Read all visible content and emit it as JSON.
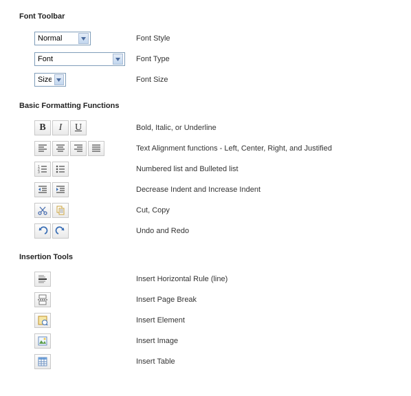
{
  "sections": {
    "font_toolbar": {
      "title": "Font Toolbar",
      "style_dd": "Normal",
      "style_desc": "Font Style",
      "font_dd": "Font",
      "font_desc": "Font Type",
      "size_dd": "Size",
      "size_desc": "Font Size"
    },
    "basic": {
      "title": "Basic Formatting Functions",
      "biu_desc": "Bold, Italic, or Underline",
      "align_desc": "Text Alignment functions - Left, Center, Right, and Justified",
      "list_desc": "Numbered list and Bulleted list",
      "indent_desc": "Decrease Indent and Increase Indent",
      "cutcopy_desc": "Cut, Copy",
      "undo_desc": "Undo and Redo"
    },
    "insert": {
      "title": "Insertion Tools",
      "hr_desc": "Insert Horizontal Rule (line)",
      "pb_desc": "Insert Page Break",
      "elem_desc": "Insert Element",
      "img_desc": "Insert Image",
      "tbl_desc": "Insert Table"
    }
  },
  "glyphs": {
    "b": "B",
    "i": "I",
    "u": "U"
  }
}
